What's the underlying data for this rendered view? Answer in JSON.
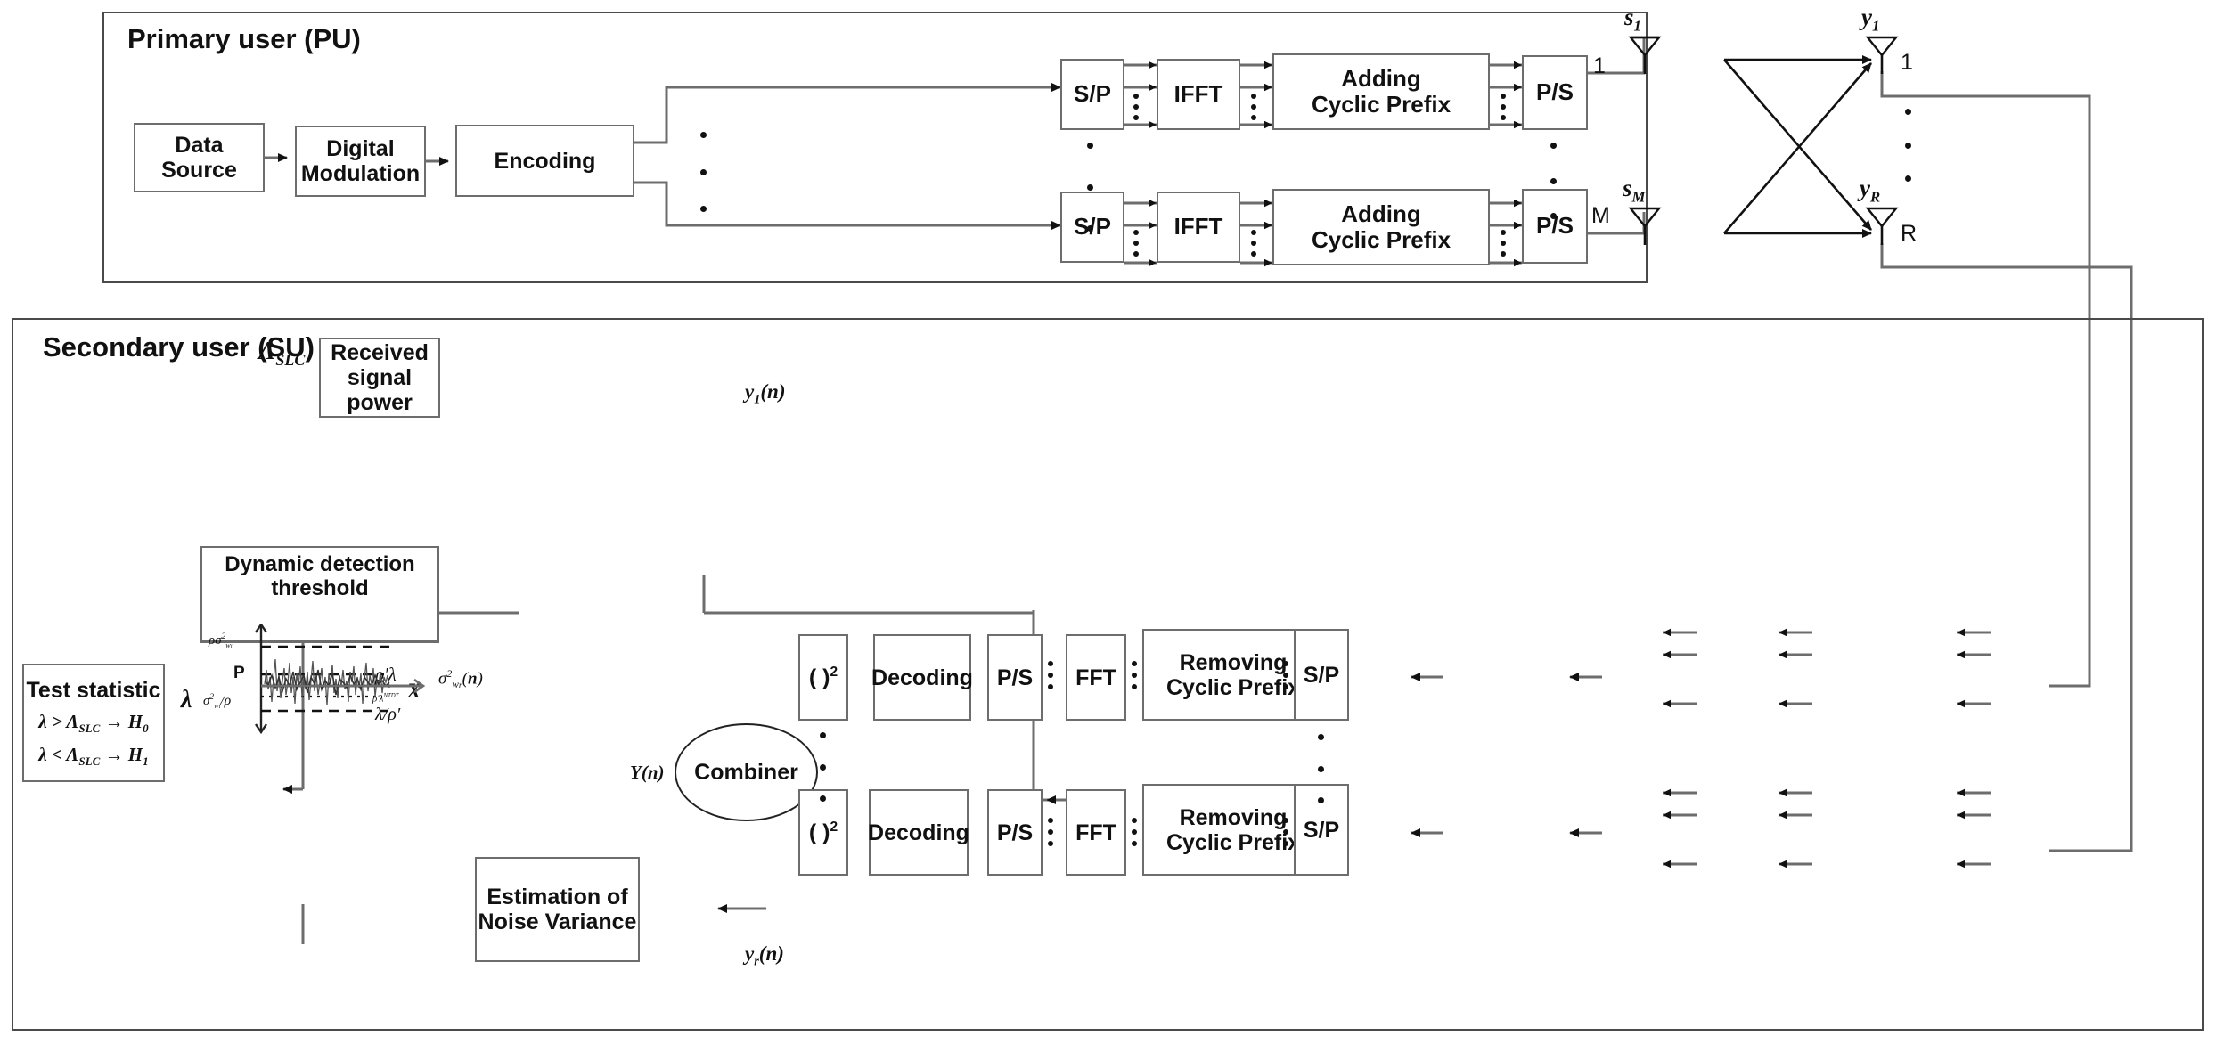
{
  "panels": {
    "pu": {
      "title": "Primary user (PU)"
    },
    "su": {
      "title": "Secondary user (SU)"
    }
  },
  "transmitter": {
    "data_source": "Data\nSource",
    "digital_modulation": "Digital\nModulation",
    "encoding": "Encoding",
    "chain": [
      {
        "sp": "S/P",
        "ifft": "IFFT",
        "cp": "Adding\nCyclic Prefix",
        "ps": "P/S",
        "index": "1"
      },
      {
        "sp": "S/P",
        "ifft": "IFFT",
        "cp": "Adding\nCyclic Prefix",
        "ps": "P/S",
        "index": "M"
      }
    ]
  },
  "antennas": {
    "tx_first_label": "s",
    "tx_first_sub": "1",
    "tx_last_label": "s",
    "tx_last_sub": "M",
    "rx_first_label": "y",
    "rx_first_sub": "1",
    "rx_last_label": "y",
    "rx_last_sub": "R",
    "rx_first_index": "1",
    "rx_last_index": "R"
  },
  "receiver": {
    "chain": [
      {
        "sp": "S/P",
        "cp": "Removing\nCyclic Prefix",
        "fft": "FFT",
        "ps": "P/S",
        "dec": "Decoding",
        "sq": "( )",
        "sq_exp": "2"
      },
      {
        "sp": "S/P",
        "cp": "Removing\nCyclic Prefix",
        "fft": "FFT",
        "ps": "P/S",
        "dec": "Decoding",
        "sq": "( )",
        "sq_exp": "2"
      }
    ],
    "combiner": "Combiner",
    "y_first": "y₁(n)",
    "y_last": "y_r(n)",
    "combiner_out": "Y(n)"
  },
  "su_blocks": {
    "received_signal_power": "Received\nsignal power",
    "estimation_noise_variance": "Estimation of\nNoise Variance",
    "dynamic_threshold_title": "Dynamic detection\nthreshold",
    "test_statistic_title": "Test statistic",
    "test_statistic_line1": "λ > Λ_SLC → H₀",
    "test_statistic_line2": "λ < Λ_SLC → H₁",
    "lambda_slc": "Λ_SLC",
    "lambda": "λ",
    "sigma_wr_n": "σ²_wr(n)"
  },
  "chart_data": {
    "type": "line",
    "title": "Dynamic detection threshold",
    "xlabel": "X",
    "ylabel": "",
    "ytick_labels": [
      "ρσ²_wi",
      "P",
      "σ²_wi/ρ"
    ],
    "ytick_values": [
      1.0,
      0.5,
      0.0
    ],
    "threshold_lines": [
      {
        "label": "ρσ²_wi",
        "y": 1.0,
        "style": "dashed"
      },
      {
        "label": "ρ'λ",
        "y": 0.56,
        "style": "dashed"
      },
      {
        "label": "ρ'λ^NTDT",
        "y": 0.37,
        "style": "dotted"
      },
      {
        "label": "λ/ρ'",
        "y": 0.0,
        "style": "dashed"
      }
    ],
    "series": [
      {
        "name": "received power",
        "description": "noisy fluctuating signal around P"
      }
    ],
    "grid": false,
    "legend": "none"
  },
  "colors": {
    "line": "#6d6d6d",
    "dark": "#222222",
    "text": "#111111"
  }
}
